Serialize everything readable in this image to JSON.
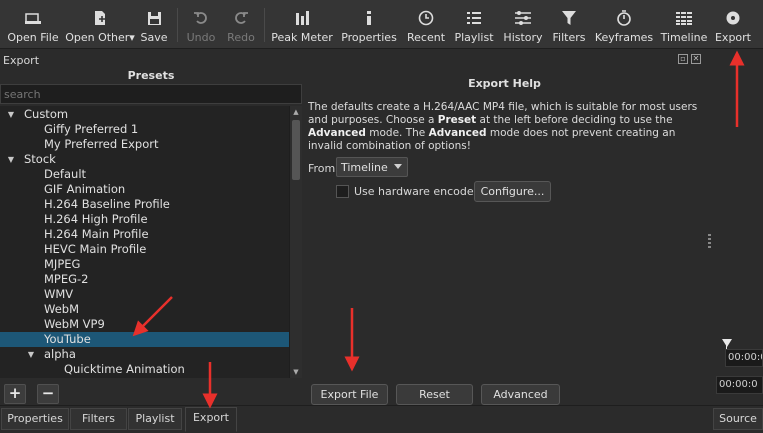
{
  "toolbar": {
    "items": [
      {
        "label": "Open File",
        "icon": "open-file-icon",
        "enabled": true
      },
      {
        "label": "Open Other",
        "icon": "open-other-icon",
        "enabled": true
      },
      {
        "label": "Save",
        "icon": "save-icon",
        "enabled": true
      },
      {
        "label": "Undo",
        "icon": "undo-icon",
        "enabled": false
      },
      {
        "label": "Redo",
        "icon": "redo-icon",
        "enabled": false
      },
      {
        "label": "Peak Meter",
        "icon": "peak-meter-icon",
        "enabled": true
      },
      {
        "label": "Properties",
        "icon": "info-icon",
        "enabled": true
      },
      {
        "label": "Recent",
        "icon": "clock-icon",
        "enabled": true
      },
      {
        "label": "Playlist",
        "icon": "list-icon",
        "enabled": true
      },
      {
        "label": "History",
        "icon": "history-icon",
        "enabled": true
      },
      {
        "label": "Filters",
        "icon": "filter-icon",
        "enabled": true
      },
      {
        "label": "Keyframes",
        "icon": "stopwatch-icon",
        "enabled": true
      },
      {
        "label": "Timeline",
        "icon": "timeline-icon",
        "enabled": true
      },
      {
        "label": "Export",
        "icon": "export-icon",
        "enabled": true
      }
    ]
  },
  "dock": {
    "title": "Export"
  },
  "presets": {
    "title": "Presets",
    "search_placeholder": "search",
    "tree": [
      {
        "label": "Custom",
        "level": 0,
        "expandable": true
      },
      {
        "label": "Giffy Preferred 1",
        "level": 1
      },
      {
        "label": "My Preferred Export",
        "level": 1
      },
      {
        "label": "Stock",
        "level": 0,
        "expandable": true
      },
      {
        "label": "Default",
        "level": 1
      },
      {
        "label": "GIF Animation",
        "level": 1
      },
      {
        "label": "H.264 Baseline Profile",
        "level": 1
      },
      {
        "label": "H.264 High Profile",
        "level": 1
      },
      {
        "label": "H.264 Main Profile",
        "level": 1
      },
      {
        "label": "HEVC Main Profile",
        "level": 1
      },
      {
        "label": "MJPEG",
        "level": 1
      },
      {
        "label": "MPEG-2",
        "level": 1
      },
      {
        "label": "WMV",
        "level": 1
      },
      {
        "label": "WebM",
        "level": 1
      },
      {
        "label": "WebM VP9",
        "level": 1
      },
      {
        "label": "YouTube",
        "level": 1,
        "selected": true
      },
      {
        "label": "alpha",
        "level": 1,
        "expandable": true
      },
      {
        "label": "Quicktime Animation",
        "level": 2
      }
    ],
    "add_label": "+",
    "remove_label": "−"
  },
  "help": {
    "title": "Export Help",
    "text_1": "The defaults create a H.264/AAC MP4 file, which is suitable for most users and purposes. Choose a ",
    "text_preset": "Preset",
    "text_2": " at the left before deciding to use the ",
    "text_advanced": "Advanced",
    "text_3": " mode. The ",
    "text_advanced2": "Advanced",
    "text_4": " mode does not prevent creating an invalid combination of options!",
    "from_label": "From",
    "from_value": "Timeline",
    "hw_encoder_label": "Use hardware encoder",
    "hw_encoder_checked": false,
    "configure_label": "Configure...",
    "export_file_label": "Export File",
    "reset_label": "Reset",
    "advanced_label": "Advanced"
  },
  "right": {
    "timecode_1": "00:00:0",
    "timecode_2": "00:00:0"
  },
  "tabs": {
    "items": [
      {
        "label": "Properties",
        "active": false
      },
      {
        "label": "Filters",
        "active": false
      },
      {
        "label": "Playlist",
        "active": false
      },
      {
        "label": "Export",
        "active": true
      }
    ],
    "source_label": "Source"
  },
  "colors": {
    "background": "#2b2b2b",
    "selection": "#1d5777",
    "annotation": "#e8302b"
  }
}
